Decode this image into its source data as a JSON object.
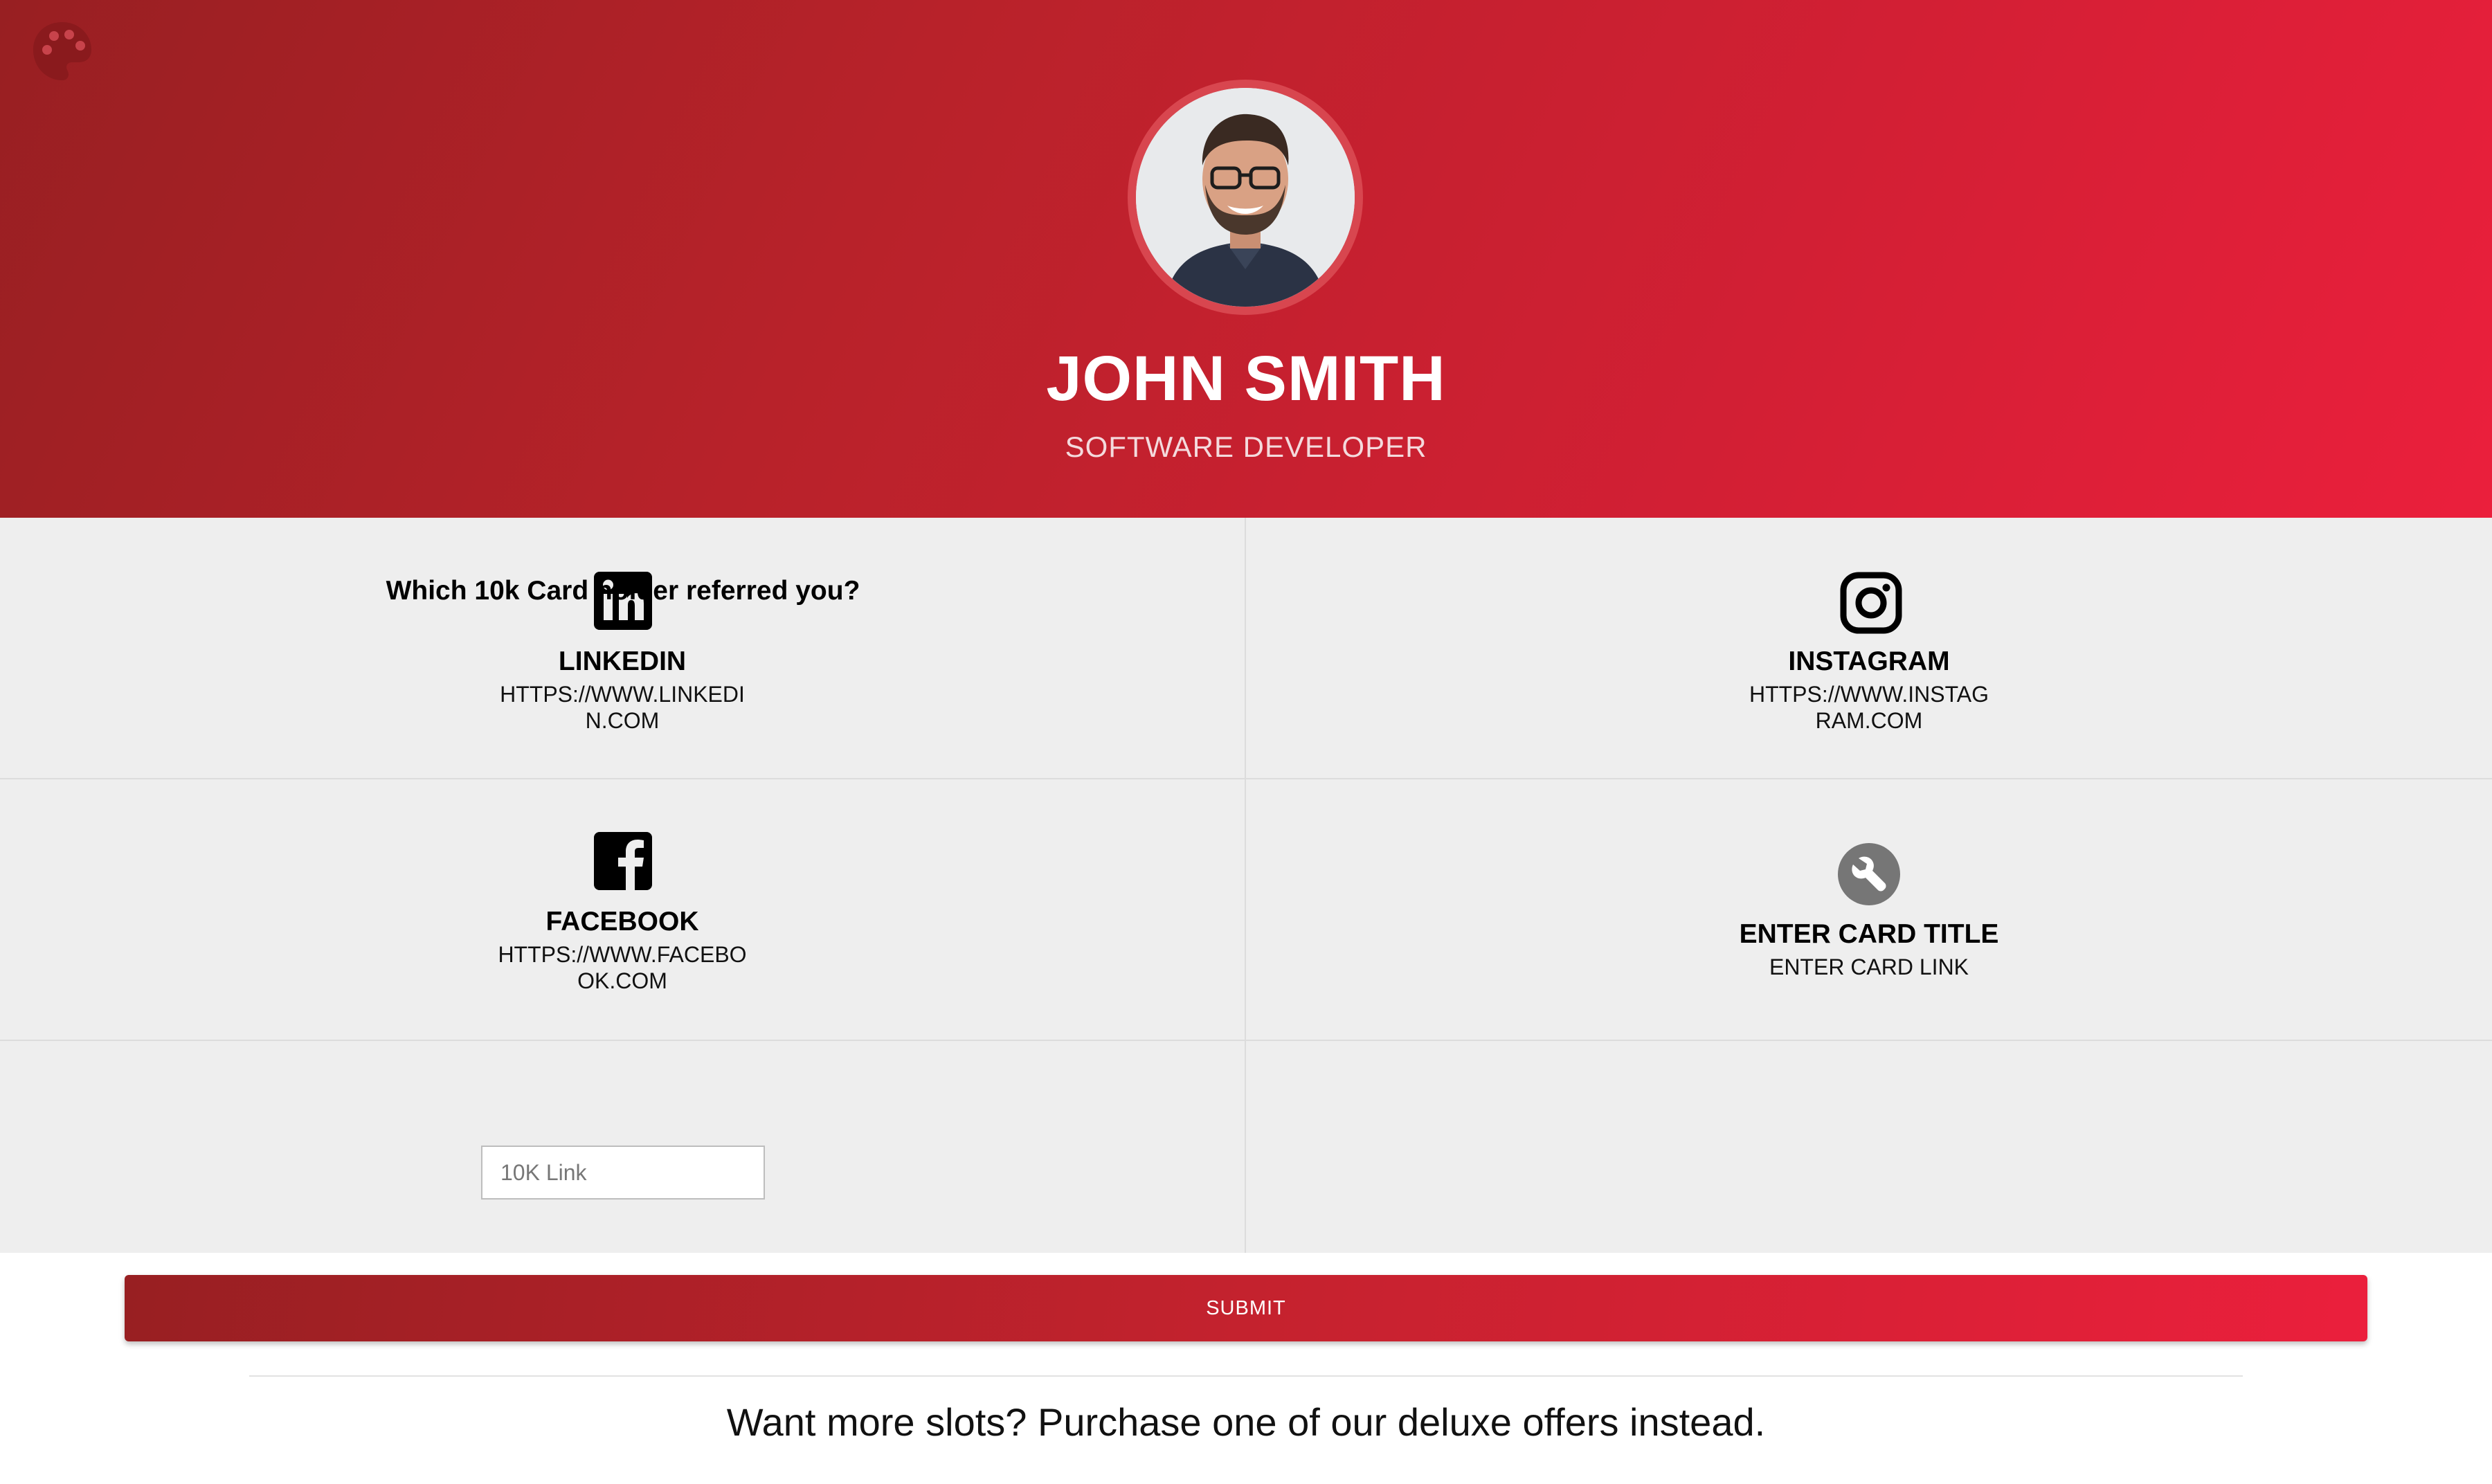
{
  "profile": {
    "name": "JOHN SMITH",
    "title": "SOFTWARE DEVELOPER",
    "avatar_icon": "profile-photo",
    "palette_icon": "palette-icon"
  },
  "cards": [
    {
      "label": "LINKEDIN",
      "link": "HTTPS://WWW.LINKEDIN.COM",
      "icon": "linkedin-icon"
    },
    {
      "label": "INSTAGRAM",
      "link": "HTTPS://WWW.INSTAGRAM.COM",
      "icon": "instagram-icon"
    },
    {
      "label": "FACEBOOK",
      "link": "HTTPS://WWW.FACEBOOK.COM",
      "icon": "facebook-icon"
    },
    {
      "label": "ENTER CARD TITLE",
      "link": "ENTER CARD LINK",
      "icon": "wrench-icon"
    }
  ],
  "referral": {
    "question": "Which 10k Card holder referred you?",
    "placeholder": "10K Link"
  },
  "submit_label": "SUBMIT",
  "footer_text": "Want more slots? Purchase one of our deluxe offers instead.",
  "colors": {
    "header_start": "#981f22",
    "header_end": "#eb1f3c",
    "grid_background": "#eeeeee"
  }
}
